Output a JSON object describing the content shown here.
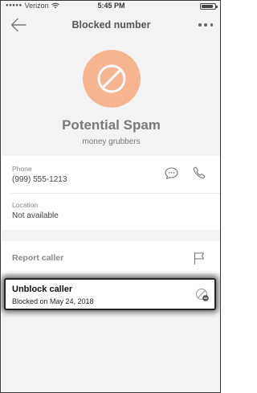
{
  "status_bar": {
    "carrier": "Verizon",
    "time": "5:45 PM",
    "battery_level": 0.85
  },
  "header": {
    "title": "Blocked number"
  },
  "caller": {
    "name": "Potential Spam",
    "note": "money grubbers",
    "avatar_color": "#f6b48f"
  },
  "phone": {
    "label": "Phone",
    "value": "(999) 555-1213"
  },
  "location": {
    "label": "Location",
    "value": "Not available"
  },
  "report": {
    "label": "Report caller"
  },
  "unblock": {
    "title": "Unblock caller",
    "subtitle": "Blocked on May 24, 2018"
  },
  "icons": {
    "back": "arrow-left-icon",
    "more": "more-dots-icon",
    "message": "message-icon",
    "call": "phone-icon",
    "flag": "flag-icon",
    "unblock": "unblock-icon",
    "avatar": "blocked-circle-icon"
  }
}
